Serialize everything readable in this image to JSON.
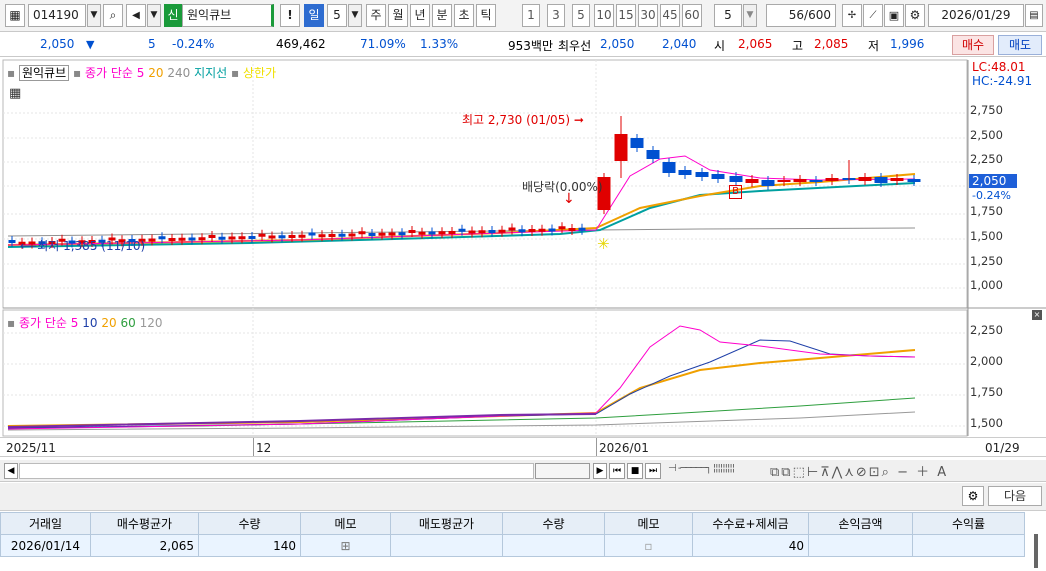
{
  "toolbar": {
    "code": "014190",
    "stock_badge": "신",
    "stock_name": "원익큐브",
    "periods": [
      "일",
      "5",
      "주",
      "월",
      "년",
      "분",
      "초",
      "틱"
    ],
    "quick_minutes": [
      "1",
      "3",
      "5",
      "10",
      "15",
      "30",
      "45",
      "60"
    ],
    "period_value": "5",
    "count": "56/600",
    "date": "2026/01/29"
  },
  "quote": {
    "price": "2,050",
    "arrow": "▼",
    "change": "5",
    "change_pct": "-0.24%",
    "volume": "469,462",
    "ratio1": "71.09%",
    "ratio2": "1.33%",
    "amount": "953백만",
    "best_label": "최우선",
    "ask": "2,050",
    "bid": "2,040",
    "open_label": "시",
    "open": "2,065",
    "high_label": "고",
    "high": "2,085",
    "low_label": "저",
    "low": "1,996",
    "buy": "매수",
    "sell": "매도"
  },
  "legend_price": {
    "name": "원익큐브",
    "ma": "종가 단순",
    "p1": "5",
    "p2": "20",
    "p3": "240",
    "support": "지지선",
    "limit": "상한가",
    "lc": "LC:48.01",
    "hc": "HC:-24.91"
  },
  "annotations": {
    "high": "최고 2,730 (01/05)",
    "dividend": "배당락(0.00%)",
    "low": "최저 1,385 (11/10)",
    "b_marker": "B"
  },
  "legend_vol": {
    "ma": "종가 단순",
    "p1": "5",
    "p2": "10",
    "p3": "20",
    "p4": "60",
    "p5": "120"
  },
  "axis_price": [
    "2,750",
    "2,500",
    "2,250",
    "2,000",
    "1,750",
    "1,500",
    "1,250",
    "1,000"
  ],
  "current_price": "2,050",
  "current_pct": "-0.24%",
  "axis_ma": [
    "2,250",
    "2,000",
    "1,750",
    "1,500"
  ],
  "dates": {
    "d1": "2025/11",
    "d2": "12",
    "d3": "2026/01",
    "d4": "01/29"
  },
  "colors": {
    "up": "#e00000",
    "down": "#0050d0",
    "ma5": "#ff00cc",
    "ma20": "#f0a000",
    "ma240": "#909090",
    "support": "#00a0a0",
    "ma10": "#1e3fa8",
    "ma60": "#2e9e3e",
    "ma120": "#999999"
  },
  "next_button": "다음",
  "table": {
    "headers": [
      "거래일",
      "매수평균가",
      "수량",
      "메모",
      "매도평균가",
      "수량",
      "메모",
      "수수료+제세금",
      "손익금액",
      "수익률"
    ],
    "rows": [
      [
        "2026/01/14",
        "2,065",
        "140",
        "",
        "",
        "",
        "",
        "40",
        "",
        ""
      ]
    ]
  }
}
